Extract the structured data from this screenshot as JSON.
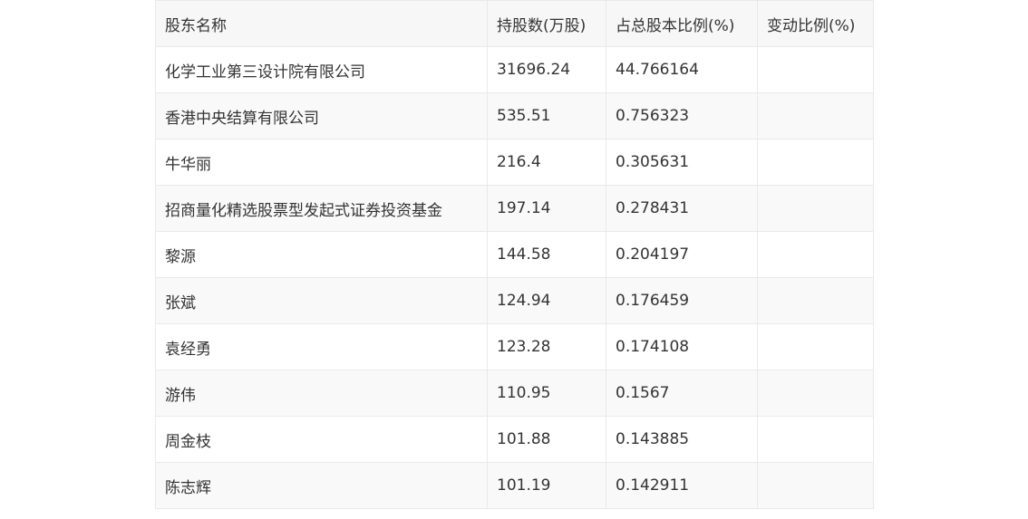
{
  "table": {
    "headers": [
      "股东名称",
      "持股数(万股)",
      "占总股本比例(%)",
      "变动比例(%)"
    ],
    "rows": [
      [
        "化学工业第三设计院有限公司",
        "31696.24",
        "44.766164",
        ""
      ],
      [
        "香港中央结算有限公司",
        "535.51",
        "0.756323",
        ""
      ],
      [
        "牛华丽",
        "216.4",
        "0.305631",
        ""
      ],
      [
        "招商量化精选股票型发起式证券投资基金",
        "197.14",
        "0.278431",
        ""
      ],
      [
        "黎源",
        "144.58",
        "0.204197",
        ""
      ],
      [
        "张斌",
        "124.94",
        "0.176459",
        ""
      ],
      [
        "袁经勇",
        "123.28",
        "0.174108",
        ""
      ],
      [
        "游伟",
        "110.95",
        "0.1567",
        ""
      ],
      [
        "周金枝",
        "101.88",
        "0.143885",
        ""
      ],
      [
        "陈志辉",
        "101.19",
        "0.142911",
        ""
      ]
    ]
  }
}
